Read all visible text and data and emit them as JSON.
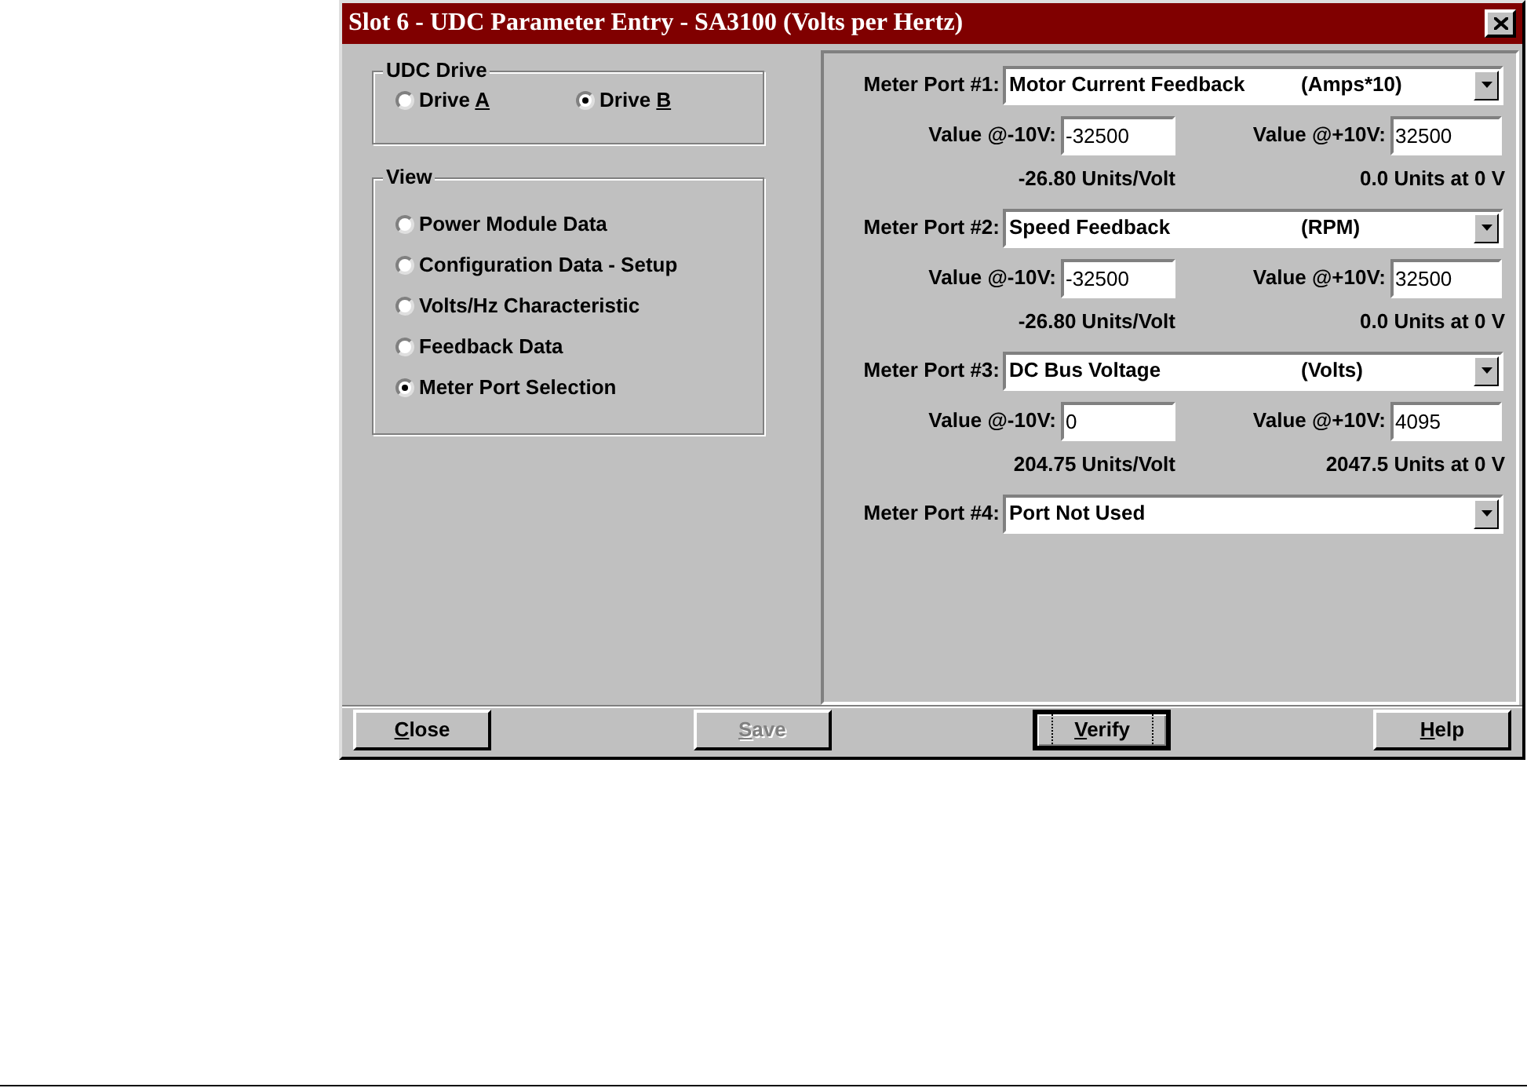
{
  "window": {
    "title": "Slot 6 - UDC Parameter Entry - SA3100 (Volts per Hertz)"
  },
  "udc_drive": {
    "title": "UDC Drive",
    "options": [
      {
        "label": "Drive ",
        "accel": "A",
        "selected": false
      },
      {
        "label": "Drive ",
        "accel": "B",
        "selected": true
      }
    ]
  },
  "view": {
    "title": "View",
    "options": [
      {
        "label": "Power Module Data",
        "selected": false
      },
      {
        "label": "Configuration Data - Setup",
        "selected": false
      },
      {
        "label": "Volts/Hz Characteristic",
        "selected": false
      },
      {
        "label": "Feedback Data",
        "selected": false
      },
      {
        "label": "Meter Port Selection",
        "selected": true
      }
    ]
  },
  "meter_ports": [
    {
      "label": "Meter Port #1:",
      "selection": "Motor Current Feedback",
      "unit": "(Amps*10)",
      "low_label": "Value @-10V:",
      "low_value": "-32500",
      "high_label": "Value @+10V:",
      "high_value": "32500",
      "slope": "-26.80 Units/Volt",
      "offset": "0.0 Units at 0 V"
    },
    {
      "label": "Meter Port #2:",
      "selection": "Speed Feedback",
      "unit": "(RPM)",
      "low_label": "Value @-10V:",
      "low_value": "-32500",
      "high_label": "Value @+10V:",
      "high_value": "32500",
      "slope": "-26.80 Units/Volt",
      "offset": "0.0 Units at 0 V"
    },
    {
      "label": "Meter Port #3:",
      "selection": "DC Bus Voltage",
      "unit": "(Volts)",
      "low_label": "Value @-10V:",
      "low_value": "0",
      "high_label": "Value @+10V:",
      "high_value": "4095",
      "slope": "204.75 Units/Volt",
      "offset": "2047.5 Units at 0 V"
    },
    {
      "label": "Meter Port #4:",
      "selection": "Port Not Used"
    }
  ],
  "buttons": [
    {
      "accel": "C",
      "rest": "lose",
      "disabled": false,
      "focused": false
    },
    {
      "accel": "S",
      "rest": "ave",
      "disabled": true,
      "focused": false
    },
    {
      "accel": "V",
      "rest": "erify",
      "disabled": false,
      "focused": true
    },
    {
      "accel": "H",
      "rest": "elp",
      "disabled": false,
      "focused": false
    }
  ]
}
